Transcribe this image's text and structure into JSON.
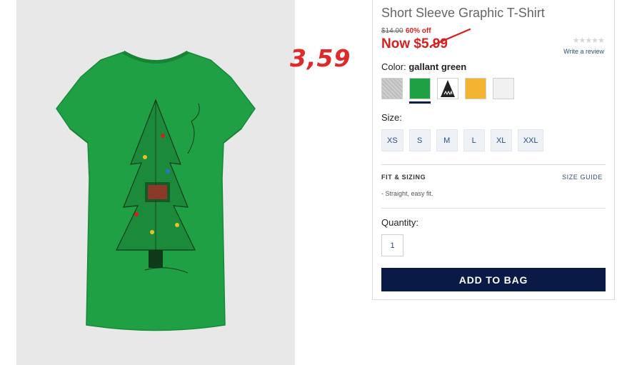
{
  "product": {
    "title": "Short Sleeve Graphic T-Shirt",
    "original_price": "$14.00",
    "discount": "60% off",
    "now_price": "Now $5.99",
    "annotation": "3,59"
  },
  "rating": {
    "stars": "★★★★★",
    "write_review": "Write a review"
  },
  "color": {
    "label": "Color:",
    "selected": "gallant green",
    "swatches": [
      {
        "name": "heather grey",
        "hex": "#c9c9c9"
      },
      {
        "name": "gallant green",
        "hex": "#1fa045",
        "selected": true
      },
      {
        "name": "shark graphic",
        "hex": "#222222"
      },
      {
        "name": "yellow",
        "hex": "#f2b431"
      },
      {
        "name": "white",
        "hex": "#f1f1f1"
      }
    ]
  },
  "size": {
    "label": "Size:",
    "options": [
      "XS",
      "S",
      "M",
      "L",
      "XL",
      "XXL"
    ]
  },
  "fit": {
    "title": "FIT & SIZING",
    "guide": "SIZE GUIDE",
    "description": "- Straight, easy fit."
  },
  "quantity": {
    "label": "Quantity:",
    "value": "1"
  },
  "cta": {
    "add_to_bag": "ADD TO BAG"
  },
  "colors": {
    "sale_red": "#d62020",
    "navy": "#0a1a47",
    "link_blue": "#2d4d80",
    "shirt_green": "#1fa045"
  }
}
